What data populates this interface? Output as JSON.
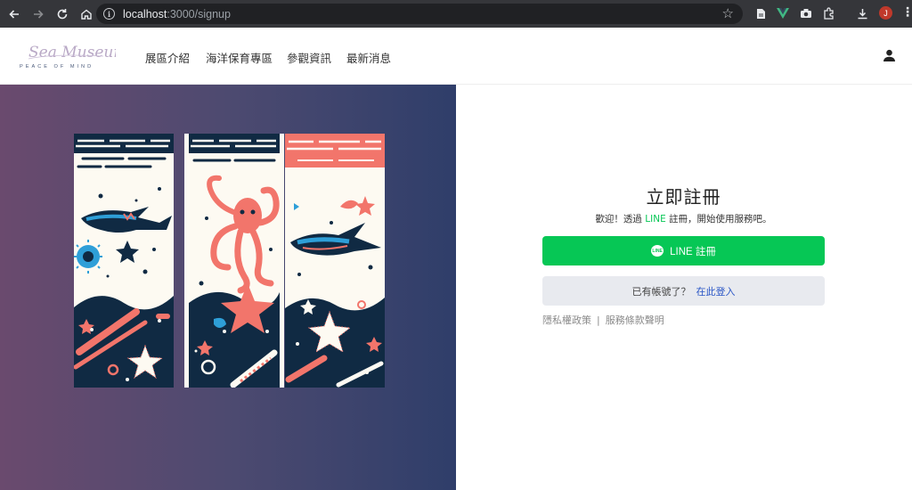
{
  "browser": {
    "url_host": "localhost",
    "url_path": ":3000/signup",
    "profile_initial": "J",
    "icons": [
      "back-icon",
      "forward-icon",
      "reload-icon",
      "home-icon",
      "info-icon",
      "star-icon",
      "document-icon",
      "vue-devtools-icon",
      "camera-icon",
      "extensions-icon",
      "download-icon",
      "profile-avatar",
      "menu-icon"
    ]
  },
  "header": {
    "logo_script": "Sea Museum",
    "logo_tagline": "PEACE OF MIND",
    "nav": [
      "展區介紹",
      "海洋保育專區",
      "參觀資訊",
      "最新消息"
    ],
    "user_icon": "user-icon"
  },
  "signup": {
    "title": "立即註冊",
    "subtitle_pre": "歡迎！透過 ",
    "subtitle_line": "LINE",
    "subtitle_post": " 註冊，開始使用服務吧。",
    "line_button_label": "LINE 註冊",
    "line_badge": "LINE",
    "have_account": "已有帳號了？",
    "login_link": "在此登入",
    "privacy": "隱私權政策",
    "separator": "|",
    "terms": "服務條款聲明"
  },
  "colors": {
    "line_green": "#06c755",
    "link_blue": "#2a56c6",
    "hero_left": "#6a4a6e",
    "hero_right": "#2f3e6a",
    "coral": "#f2756b",
    "navy": "#102a43",
    "sky": "#2e9fd8"
  }
}
